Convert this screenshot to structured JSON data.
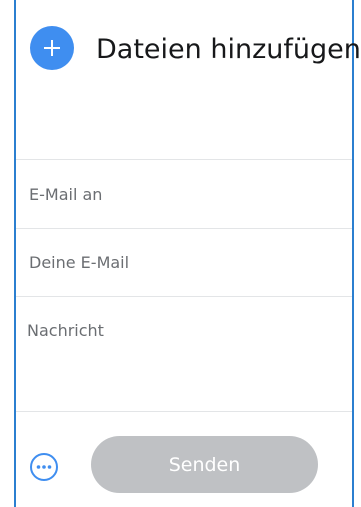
{
  "upload": {
    "add_icon": "plus-icon",
    "title": "Dateien hinzufügen"
  },
  "form": {
    "email_to_placeholder": "E-Mail an",
    "your_email_placeholder": "Deine E-Mail",
    "message_placeholder": "Nachricht"
  },
  "footer": {
    "more_icon": "more-options-icon",
    "send_label": "Senden"
  },
  "colors": {
    "accent": "#3f8ef0",
    "panel_border": "#2b7fd0",
    "send_disabled": "#bfc1c4"
  }
}
